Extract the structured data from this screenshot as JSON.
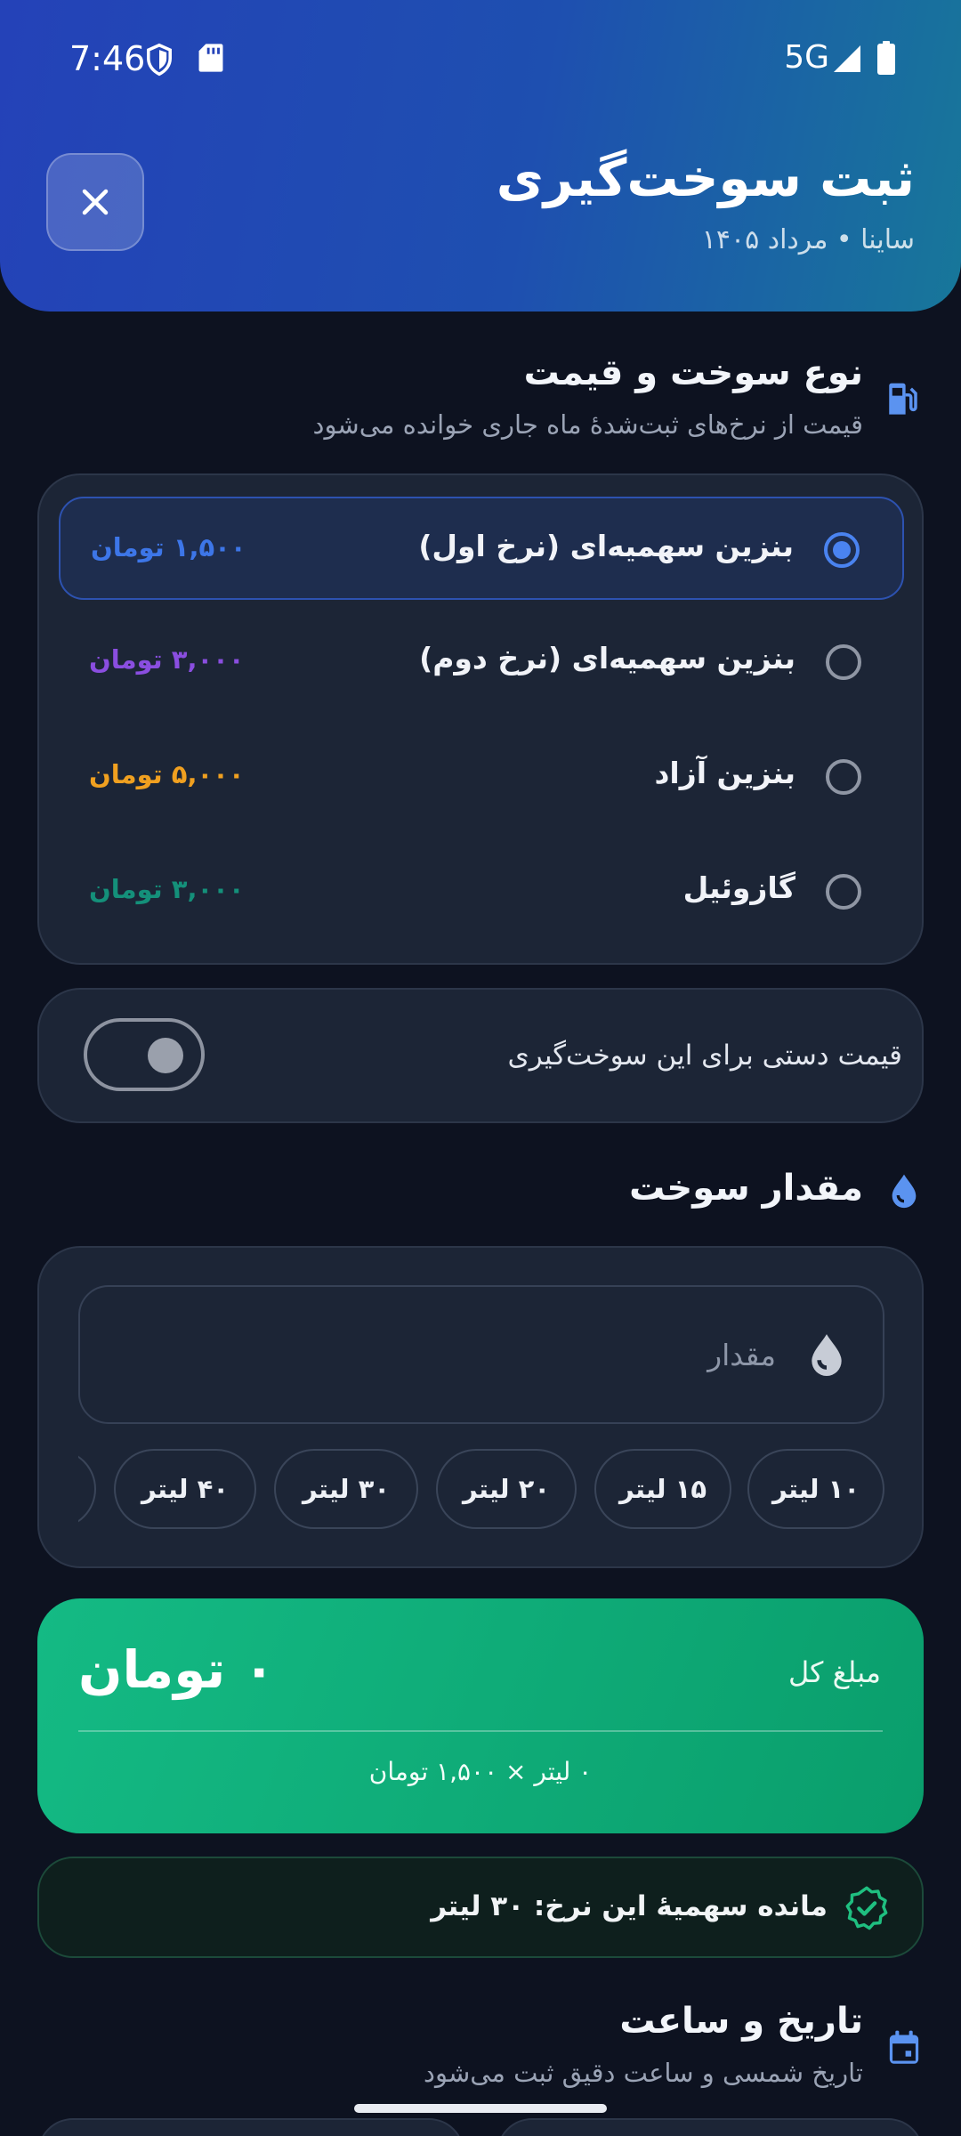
{
  "status_bar": {
    "time": "7:46",
    "network": "5G"
  },
  "header": {
    "title": "ثبت سوخت‌گیری",
    "subtitle": "ساینا • مرداد ۱۴۰۵",
    "close_icon": "close-icon"
  },
  "fuel_section": {
    "title": "نوع سوخت و قیمت",
    "subtitle": "قیمت از نرخ‌های ثبت‌شدهٔ ماه جاری خوانده می‌شود",
    "icon": "fuel-pump-icon",
    "options": [
      {
        "name": "بنزین سهمیه‌ای (نرخ اول)",
        "price": "۱,۵۰۰ تومان",
        "color": "#3d76e8",
        "selected": true
      },
      {
        "name": "بنزین سهمیه‌ای (نرخ دوم)",
        "price": "۳,۰۰۰ تومان",
        "color": "#8a4ee0",
        "selected": false
      },
      {
        "name": "بنزین آزاد",
        "price": "۵,۰۰۰ تومان",
        "color": "#f0a020",
        "selected": false
      },
      {
        "name": "گازوئیل",
        "price": "۳,۰۰۰ تومان",
        "color": "#14907a",
        "selected": false
      }
    ]
  },
  "manual_price": {
    "label": "قیمت دستی برای این سوخت‌گیری",
    "enabled": false
  },
  "amount_section": {
    "title": "مقدار سوخت",
    "icon": "drop-icon",
    "placeholder": "مقدار",
    "chips": [
      "۱۰ لیتر",
      "۱۵ لیتر",
      "۲۰ لیتر",
      "۳۰ لیتر",
      "۴۰ لیتر"
    ]
  },
  "total": {
    "label": "مبلغ کل",
    "amount": "۰ تومان",
    "formula": "۰ لیتر × ۱,۵۰۰ تومان",
    "color": "#10b07a"
  },
  "quota": {
    "text": "مانده سهمیهٔ این نرخ: ۳۰ لیتر",
    "icon": "verified-badge-icon"
  },
  "datetime_section": {
    "title": "تاریخ و ساعت",
    "subtitle": "تاریخ شمسی و ساعت دقیق ثبت می‌شود",
    "icon": "calendar-icon"
  }
}
